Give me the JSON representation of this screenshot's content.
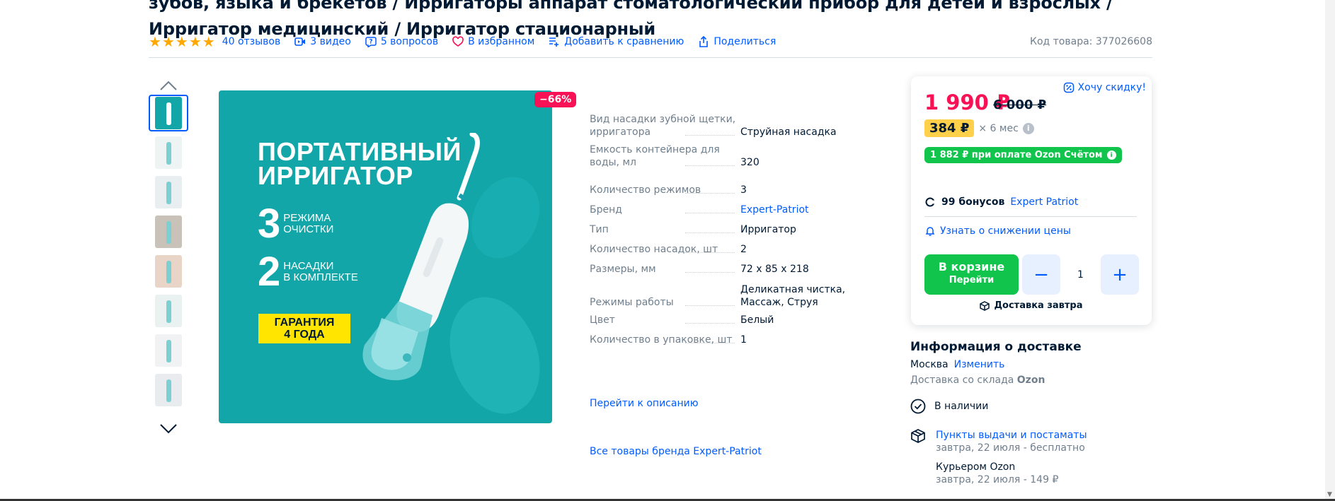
{
  "title": "зубов, языка и брекетов / Ирригаторы аппарат стоматологический прибор для детей и взрослых / Ирригатор медицинский / Ирригатор стационарный",
  "meta": {
    "reviews": "40 отзывов",
    "videos": "3 видео",
    "questions": "5 вопросов",
    "favorite": "В избранном",
    "compare": "Добавить к сравнению",
    "share": "Поделиться",
    "code": "Код товара: 377026608",
    "rating_stars": 5
  },
  "gallery": {
    "discount": "−66%",
    "promo": {
      "title_line1": "ПОРТАТИВНЫЙ",
      "title_line2": "ИРРИГАТОР",
      "num1": "3",
      "text1_line1": "РЕЖИМА",
      "text1_line2": "ОЧИСТКИ",
      "num2": "2",
      "text2_line1": "НАСАДКИ",
      "text2_line2": "В КОМПЛЕКТЕ",
      "badge_line1": "ГАРАНТИЯ",
      "badge_line2": "4 ГОДА"
    },
    "thumbs": [
      {
        "name": "thumb-1",
        "color": "#13a6a9"
      },
      {
        "name": "thumb-2",
        "color": "#eef4f4"
      },
      {
        "name": "thumb-3",
        "color": "#e9eef0"
      },
      {
        "name": "thumb-4",
        "color": "#c9c2b8"
      },
      {
        "name": "thumb-5",
        "color": "#e9d4c8"
      },
      {
        "name": "thumb-6",
        "color": "#eaf1f1"
      },
      {
        "name": "thumb-7",
        "color": "#f0f2f3"
      },
      {
        "name": "thumb-8",
        "color": "#e8ecee"
      }
    ]
  },
  "specs": [
    {
      "name": "Вид насадки зубной щетки, ирригатора",
      "value": "Струйная насадка"
    },
    {
      "name": "Емкость контейнера для воды, мл",
      "value": "320"
    },
    {
      "name": "Количество режимов",
      "value": "3"
    },
    {
      "name": "Бренд",
      "value": "Expert-Patriot",
      "link": true
    },
    {
      "name": "Тип",
      "value": "Ирригатор"
    },
    {
      "name": "Количество насадок, шт",
      "value": "2"
    },
    {
      "name": "Размеры, мм",
      "value": "72 х 85 х 218"
    },
    {
      "name": "Режимы работы",
      "value": "Деликатная чистка, Массаж, Струя"
    },
    {
      "name": "Цвет",
      "value": "Белый"
    },
    {
      "name": "Количество в упаковке, шт",
      "value": "1"
    }
  ],
  "links": {
    "to_description": "Перейти к описанию",
    "all_brand": "Все товары бренда Expert-Patriot"
  },
  "buy": {
    "want_discount": "Хочу скидку!",
    "price": "1 990 ₽",
    "old_price": "6 000 ₽",
    "installment": "384 ₽",
    "installment_term": "× 6 мес",
    "ozon_pay": "1 882 ₽ при оплате Ozon Счётом",
    "bonus_count": "99 бонусов",
    "bonus_brand": "Expert Patriot",
    "notify": "Узнать о снижении цены",
    "cart_line1": "В корзине",
    "cart_line2": "Перейти",
    "qty": "1",
    "delivery_tomorrow": "Доставка завтра"
  },
  "delivery": {
    "title": "Информация о доставке",
    "city": "Москва",
    "change": "Изменить",
    "warehouse_prefix": "Доставка со склада",
    "warehouse_name": "Ozon",
    "availability": "В наличии",
    "options": [
      {
        "title": "Пункты выдачи и постаматы",
        "sub": "завтра, 22 июля - бесплатно",
        "link": true
      },
      {
        "title": "Курьером Ozon",
        "sub": "завтра, 22 июля - 149 ₽",
        "link": false
      }
    ]
  },
  "colors": {
    "accent": "#005bff",
    "price": "#f91155",
    "green": "#10c44c",
    "promo_bg": "#13a6a9",
    "star": "#ffa800"
  }
}
